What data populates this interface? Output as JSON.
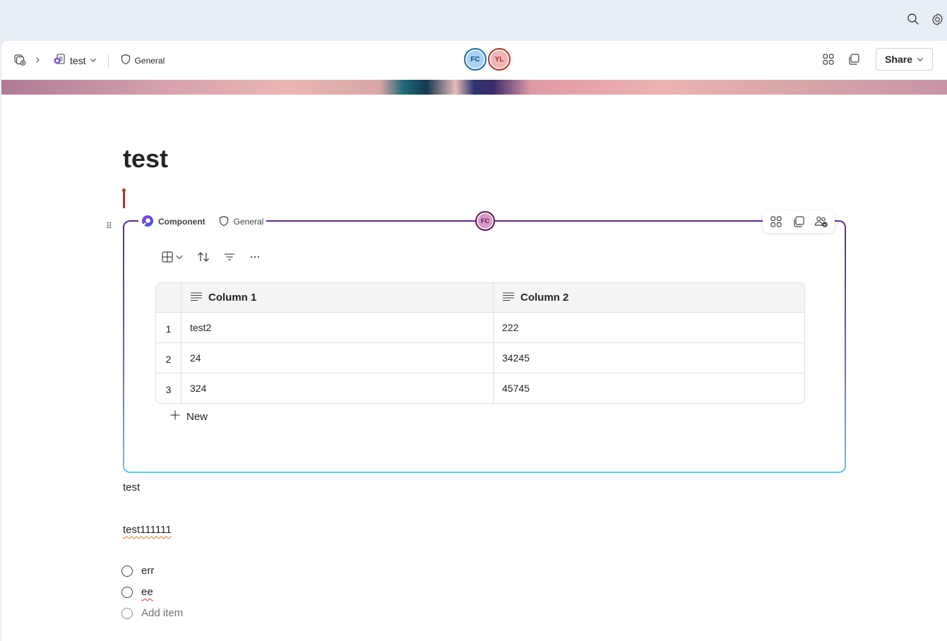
{
  "breadcrumb": {
    "page_name": "test",
    "sensitivity": "General"
  },
  "presence": {
    "users": [
      "FC",
      "YL"
    ]
  },
  "header": {
    "share_label": "Share"
  },
  "page": {
    "title": "test"
  },
  "component": {
    "label": "Component",
    "sensitivity": "General",
    "editor": "FC",
    "table": {
      "columns": [
        "Column 1",
        "Column 2"
      ],
      "rows": [
        {
          "index": "1",
          "col1": "test2",
          "col2": "222"
        },
        {
          "index": "2",
          "col1": "24",
          "col2": "34245"
        },
        {
          "index": "3",
          "col1": "324",
          "col2": "45745"
        }
      ]
    },
    "new_label": "New"
  },
  "body": {
    "line1": "test",
    "line2": "test111111",
    "checklist": [
      {
        "label": "err"
      },
      {
        "label": "ee"
      }
    ],
    "add_item_placeholder": "Add item"
  },
  "colors": {
    "accent": "#7a4fd6",
    "cursor": "#b8332b"
  }
}
